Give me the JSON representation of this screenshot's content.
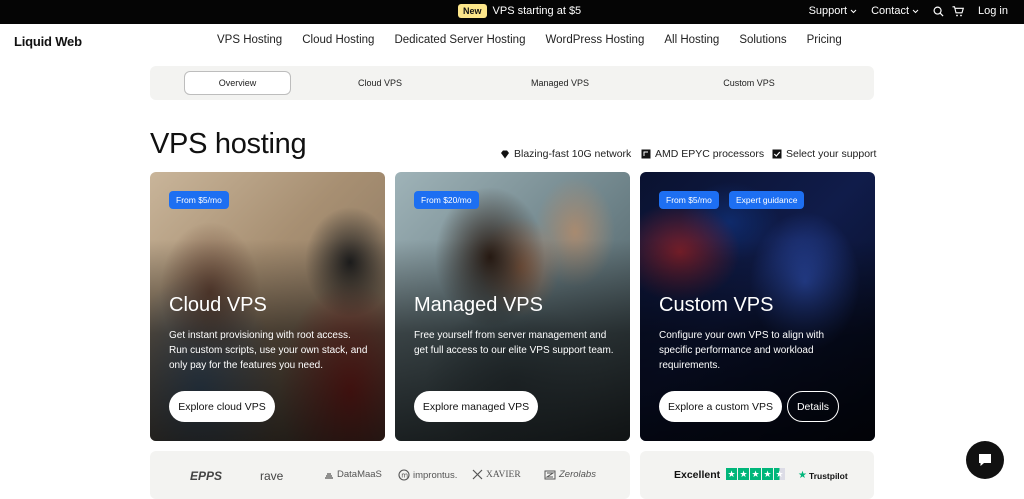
{
  "topbar": {
    "badge": "New",
    "promo": "VPS starting at $5",
    "support": "Support",
    "contact": "Contact",
    "login": "Log in"
  },
  "nav": {
    "logo": "Liquid Web",
    "links": [
      "VPS Hosting",
      "Cloud Hosting",
      "Dedicated Server Hosting",
      "WordPress Hosting",
      "All Hosting",
      "Solutions",
      "Pricing"
    ]
  },
  "subtabs": [
    "Overview",
    "Cloud VPS",
    "Managed VPS",
    "Custom VPS"
  ],
  "hero": {
    "title": "VPS hosting",
    "features": [
      "Blazing-fast 10G network",
      "AMD EPYC processors",
      "Select your support"
    ]
  },
  "cards": [
    {
      "pills": [
        "From $5/mo"
      ],
      "title": "Cloud VPS",
      "desc": "Get instant provisioning with root access. Run custom scripts, use your own stack, and only pay for the features you need.",
      "button": "Explore cloud VPS"
    },
    {
      "pills": [
        "From $20/mo"
      ],
      "title": "Managed VPS",
      "desc": "Free yourself from server management and get full access to our elite VPS support team.",
      "button": "Explore managed VPS"
    },
    {
      "pills": [
        "From $5/mo",
        "Expert guidance"
      ],
      "title": "Custom VPS",
      "desc": "Configure your own VPS to align with specific performance and workload requirements.",
      "button": "Explore a custom VPS",
      "button2": "Details"
    }
  ],
  "logos": [
    "EPPS",
    "rave",
    "DataMaaS",
    "improntus.",
    "XAVIER",
    "Zerolabs"
  ],
  "trust": {
    "excellent": "Excellent",
    "rating": 4.5,
    "brand": "Trustpilot"
  },
  "colors": {
    "accent_blue": "#1d6ff2",
    "trust_green": "#00b67a",
    "topbar": "#050505"
  }
}
